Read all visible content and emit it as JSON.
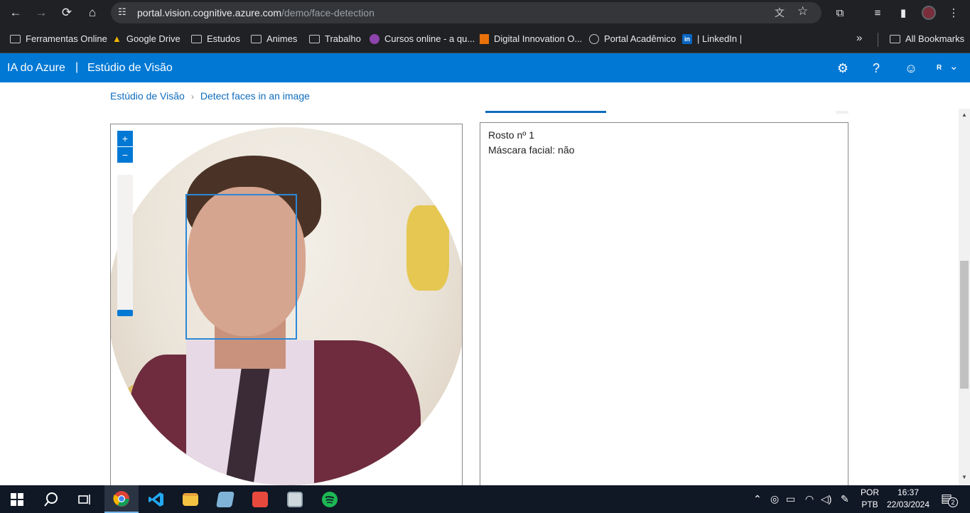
{
  "browser": {
    "url_host": "portal.vision.cognitive.azure.com",
    "url_path": "/demo/face-detection",
    "bookmarks": [
      {
        "label": "Ferramentas Online",
        "icon": "folder-icon"
      },
      {
        "label": "Google Drive",
        "icon": "google-drive-icon"
      },
      {
        "label": "Estudos",
        "icon": "folder-icon"
      },
      {
        "label": "Animes",
        "icon": "folder-icon"
      },
      {
        "label": "Trabalho",
        "icon": "folder-icon"
      },
      {
        "label": "Cursos online - a qu...",
        "icon": "site-icon"
      },
      {
        "label": "Digital Innovation O...",
        "icon": "site-icon"
      },
      {
        "label": "Portal Acadêmico",
        "icon": "globe-icon"
      },
      {
        "label": "| LinkedIn |",
        "icon": "linkedin-icon"
      }
    ],
    "all_bookmarks": "All Bookmarks",
    "more_bookmarks": "»"
  },
  "azure": {
    "brand": "IA do Azure",
    "separator": "|",
    "product": "Estúdio de Visão",
    "user_initial": "R",
    "accent": "#0078d4"
  },
  "breadcrumb": {
    "root": "Estúdio de Visão",
    "current": "Detect faces in an image"
  },
  "viewer": {
    "zoom_in": "+",
    "zoom_out": "−",
    "zoom_level": 0.05
  },
  "results": {
    "face_label": "Rosto nº 1",
    "mask_label": "Máscara facial: não"
  },
  "taskbar": {
    "language": "POR",
    "keyboard": "PTB",
    "time": "16:37",
    "date": "22/03/2024",
    "notifications": "2"
  }
}
